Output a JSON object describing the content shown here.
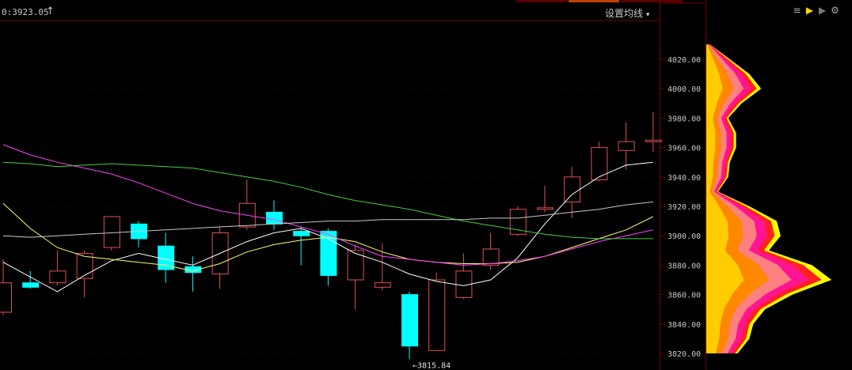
{
  "header": {
    "price_readout": "0:3923.05",
    "ma_setting_label": "设置均线",
    "ma_dropdown_glyph": "▾"
  },
  "toolbar": {
    "icons": [
      "list-icon",
      "flag-yellow-icon",
      "flag-gray-icon",
      "gear-icon"
    ]
  },
  "colors": {
    "background": "#000000",
    "up_candle": "#e05050",
    "down_candle": "#00ffff",
    "ma5": "#ffffff",
    "ma10": "#ffff66",
    "ma20": "#ff40ff",
    "ma60": "#40d040",
    "ma_long": "#c8c8c8",
    "grid": "#3a0000",
    "axis_text": "#c8c8c8"
  },
  "chart_data": {
    "type": "candlestick",
    "title": "",
    "y_axis": {
      "ticks": [
        "4020.00",
        "4000.00",
        "3980.00",
        "3960.00",
        "3940.00",
        "3920.00",
        "3900.00",
        "3880.00",
        "3860.00",
        "3840.00",
        "3820.00"
      ],
      "range": [
        3816,
        4038
      ],
      "grid": true
    },
    "low_annotation": "←3815.84",
    "candles": [
      {
        "o": 3868,
        "h": 3884,
        "l": 3846,
        "c": 3848,
        "dir": "up"
      },
      {
        "o": 3868,
        "h": 3876,
        "l": 3864,
        "c": 3865,
        "dir": "down"
      },
      {
        "o": 3868,
        "h": 3890,
        "l": 3866,
        "c": 3876,
        "dir": "up"
      },
      {
        "o": 3871,
        "h": 3890,
        "l": 3858,
        "c": 3888,
        "dir": "up"
      },
      {
        "o": 3892,
        "h": 3913,
        "l": 3890,
        "c": 3913,
        "dir": "up"
      },
      {
        "o": 3908,
        "h": 3910,
        "l": 3892,
        "c": 3898,
        "dir": "down"
      },
      {
        "o": 3893,
        "h": 3902,
        "l": 3868,
        "c": 3877,
        "dir": "down"
      },
      {
        "o": 3879,
        "h": 3886,
        "l": 3862,
        "c": 3875,
        "dir": "down"
      },
      {
        "o": 3874,
        "h": 3906,
        "l": 3864,
        "c": 3902,
        "dir": "up"
      },
      {
        "o": 3906,
        "h": 3938,
        "l": 3904,
        "c": 3922,
        "dir": "up"
      },
      {
        "o": 3916,
        "h": 3924,
        "l": 3904,
        "c": 3908,
        "dir": "down"
      },
      {
        "o": 3903,
        "h": 3906,
        "l": 3880,
        "c": 3900,
        "dir": "down"
      },
      {
        "o": 3903,
        "h": 3905,
        "l": 3866,
        "c": 3873,
        "dir": "down"
      },
      {
        "o": 3870,
        "h": 3894,
        "l": 3850,
        "c": 3890,
        "dir": "up"
      },
      {
        "o": 3865,
        "h": 3895,
        "l": 3863,
        "c": 3868,
        "dir": "up"
      },
      {
        "o": 3860,
        "h": 3862,
        "l": 3816,
        "c": 3825,
        "dir": "down"
      },
      {
        "o": 3822,
        "h": 3875,
        "l": 3822,
        "c": 3870,
        "dir": "up"
      },
      {
        "o": 3858,
        "h": 3888,
        "l": 3857,
        "c": 3876,
        "dir": "up"
      },
      {
        "o": 3880,
        "h": 3902,
        "l": 3877,
        "c": 3891,
        "dir": "up"
      },
      {
        "o": 3901,
        "h": 3920,
        "l": 3900,
        "c": 3918,
        "dir": "up"
      },
      {
        "o": 3918,
        "h": 3934,
        "l": 3916,
        "c": 3919,
        "dir": "up"
      },
      {
        "o": 3923,
        "h": 3947,
        "l": 3912,
        "c": 3940,
        "dir": "up"
      },
      {
        "o": 3938,
        "h": 3964,
        "l": 3937,
        "c": 3960,
        "dir": "up"
      },
      {
        "o": 3958,
        "h": 3977,
        "l": 3945,
        "c": 3964,
        "dir": "up"
      },
      {
        "o": 3964,
        "h": 3984,
        "l": 3957,
        "c": 3965,
        "dir": "up"
      }
    ],
    "ma_series": [
      {
        "key": "ma5",
        "values": [
          3882,
          3872,
          3862,
          3873,
          3883,
          3888,
          3884,
          3880,
          3888,
          3896,
          3902,
          3905,
          3898,
          3888,
          3882,
          3874,
          3869,
          3866,
          3870,
          3885,
          3908,
          3928,
          3940,
          3948,
          3950
        ]
      },
      {
        "key": "ma10",
        "values": [
          3922,
          3905,
          3892,
          3886,
          3884,
          3882,
          3880,
          3876,
          3881,
          3889,
          3894,
          3897,
          3899,
          3896,
          3889,
          3884,
          3882,
          3881,
          3881,
          3882,
          3886,
          3892,
          3898,
          3904,
          3913
        ]
      },
      {
        "key": "ma20",
        "values": [
          3962,
          3955,
          3950,
          3946,
          3942,
          3936,
          3929,
          3922,
          3917,
          3914,
          3911,
          3906,
          3901,
          3893,
          3886,
          3884,
          3882,
          3880,
          3881,
          3883,
          3886,
          3891,
          3896,
          3900,
          3904
        ]
      },
      {
        "key": "ma60",
        "values": [
          3950,
          3949,
          3947,
          3948,
          3949,
          3948,
          3947,
          3946,
          3943,
          3940,
          3937,
          3933,
          3928,
          3924,
          3921,
          3918,
          3914,
          3910,
          3907,
          3904,
          3901,
          3899,
          3898,
          3898,
          3898
        ]
      },
      {
        "key": "ma_long",
        "values": [
          3900,
          3899,
          3900,
          3901,
          3902,
          3903,
          3904,
          3905,
          3906,
          3907,
          3908,
          3909,
          3910,
          3910,
          3911,
          3911,
          3911,
          3911,
          3912,
          3912,
          3914,
          3916,
          3918,
          3921,
          3923
        ]
      }
    ],
    "volume_profile": {
      "note_free": true,
      "levels": [
        {
          "p": 4030,
          "a": 5
        },
        {
          "p": 4020,
          "a": 30
        },
        {
          "p": 4010,
          "a": 55
        },
        {
          "p": 4000,
          "a": 70
        },
        {
          "p": 3990,
          "a": 45
        },
        {
          "p": 3980,
          "a": 28
        },
        {
          "p": 3970,
          "a": 38
        },
        {
          "p": 3960,
          "a": 38
        },
        {
          "p": 3950,
          "a": 30
        },
        {
          "p": 3940,
          "a": 28
        },
        {
          "p": 3930,
          "a": 15
        },
        {
          "p": 3920,
          "a": 55
        },
        {
          "p": 3910,
          "a": 90
        },
        {
          "p": 3900,
          "a": 95
        },
        {
          "p": 3890,
          "a": 80
        },
        {
          "p": 3880,
          "a": 135
        },
        {
          "p": 3870,
          "a": 160
        },
        {
          "p": 3860,
          "a": 110
        },
        {
          "p": 3850,
          "a": 75
        },
        {
          "p": 3840,
          "a": 60
        },
        {
          "p": 3830,
          "a": 55
        },
        {
          "p": 3820,
          "a": 40
        }
      ]
    }
  }
}
